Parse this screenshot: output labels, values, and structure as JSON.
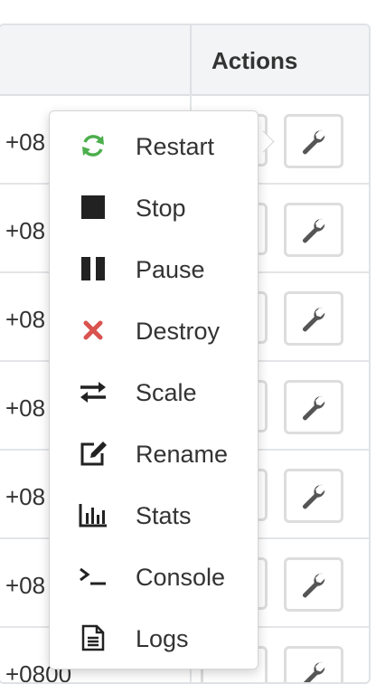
{
  "table": {
    "actions_header": "Actions",
    "rows": [
      {
        "time": "+08"
      },
      {
        "time": "+08"
      },
      {
        "time": "+08"
      },
      {
        "time": "+08"
      },
      {
        "time": "+08"
      },
      {
        "time": "+08"
      },
      {
        "time": "+0800"
      }
    ]
  },
  "menu": {
    "items": [
      {
        "label": "Restart",
        "icon": "refresh-icon",
        "color": "#4cae4c"
      },
      {
        "label": "Stop",
        "icon": "stop-icon",
        "color": "#222222"
      },
      {
        "label": "Pause",
        "icon": "pause-icon",
        "color": "#222222"
      },
      {
        "label": "Destroy",
        "icon": "destroy-x-icon",
        "color": "#d9534f"
      },
      {
        "label": "Scale",
        "icon": "exchange-arrows-icon",
        "color": "#222222"
      },
      {
        "label": "Rename",
        "icon": "edit-icon",
        "color": "#222222"
      },
      {
        "label": "Stats",
        "icon": "bar-chart-icon",
        "color": "#222222"
      },
      {
        "label": "Console",
        "icon": "terminal-icon",
        "color": "#222222"
      },
      {
        "label": "Logs",
        "icon": "file-text-icon",
        "color": "#222222"
      }
    ]
  }
}
